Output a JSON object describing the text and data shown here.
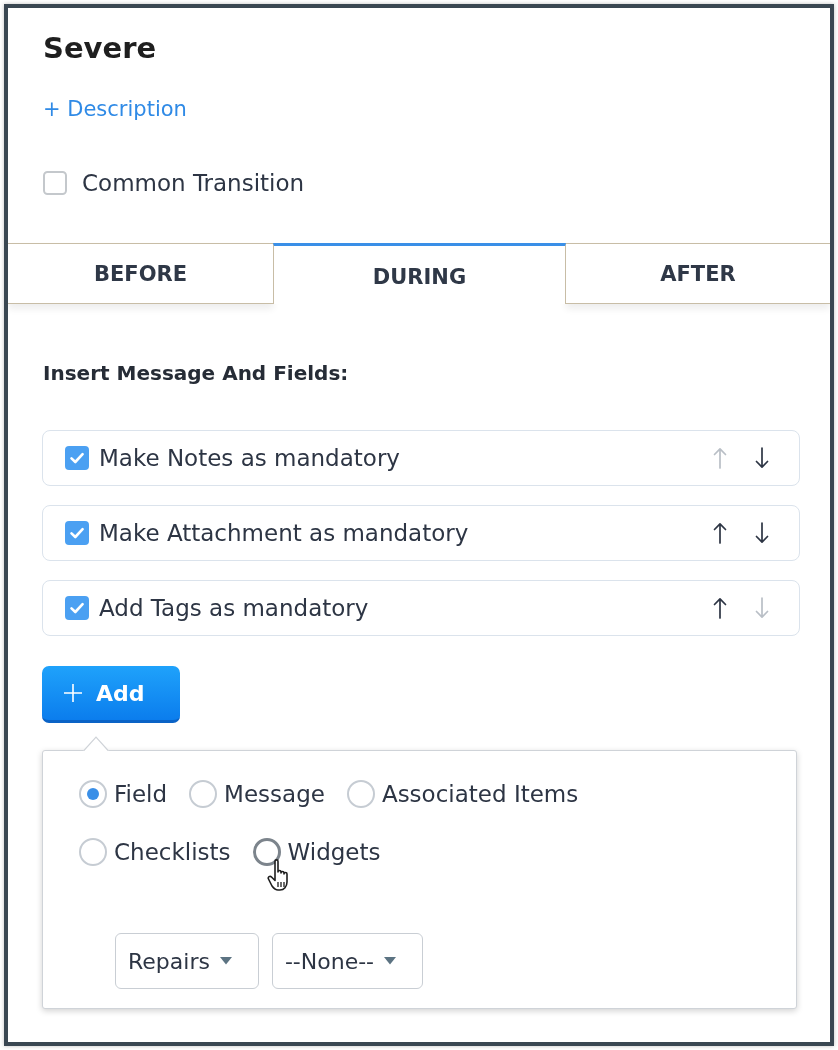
{
  "title": "Severe",
  "description_link": "+ Description",
  "common_transition": {
    "label": "Common Transition",
    "checked": false
  },
  "tabs": [
    {
      "label": "BEFORE",
      "selected": false
    },
    {
      "label": "DURING",
      "selected": true
    },
    {
      "label": "AFTER",
      "selected": false
    }
  ],
  "section_title": "Insert Message And Fields:",
  "rules": [
    {
      "label": "Make Notes as mandatory",
      "checked": true,
      "up_enabled": false,
      "down_enabled": true
    },
    {
      "label": "Make Attachment as mandatory",
      "checked": true,
      "up_enabled": true,
      "down_enabled": true
    },
    {
      "label": "Add Tags as mandatory",
      "checked": true,
      "up_enabled": true,
      "down_enabled": false
    }
  ],
  "add_button": {
    "label": "Add"
  },
  "add_menu": {
    "option_rows": [
      [
        {
          "label": "Field",
          "selected": true,
          "hovered": false
        },
        {
          "label": "Message",
          "selected": false,
          "hovered": false
        },
        {
          "label": "Associated Items",
          "selected": false,
          "hovered": false
        }
      ],
      [
        {
          "label": "Checklists",
          "selected": false,
          "hovered": false
        },
        {
          "label": "Widgets",
          "selected": false,
          "hovered": true
        }
      ]
    ],
    "selects": [
      {
        "value": "Repairs"
      },
      {
        "value": "--None--"
      }
    ]
  }
}
